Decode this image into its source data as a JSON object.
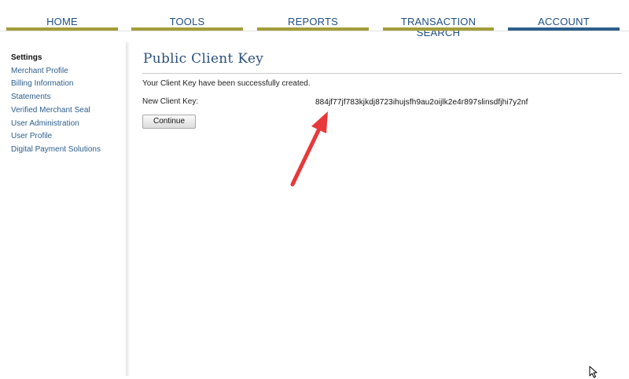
{
  "nav": {
    "tabs": [
      {
        "label": "HOME",
        "bar_color": "#a39d3a",
        "active": false
      },
      {
        "label": "TOOLS",
        "bar_color": "#a39d3a",
        "active": false
      },
      {
        "label": "REPORTS",
        "bar_color": "#a39d3a",
        "active": false
      },
      {
        "label": "TRANSACTION SEARCH",
        "bar_color": "#a39d3a",
        "active": false
      },
      {
        "label": "ACCOUNT",
        "bar_color": "#2d5f8b",
        "active": true
      }
    ]
  },
  "sidebar": {
    "heading": "Settings",
    "items": [
      {
        "label": "Merchant Profile"
      },
      {
        "label": "Billing Information"
      },
      {
        "label": "Statements"
      },
      {
        "label": "Verified Merchant Seal"
      },
      {
        "label": "User Administration"
      },
      {
        "label": "User Profile"
      },
      {
        "label": "Digital Payment Solutions"
      }
    ]
  },
  "main": {
    "title": "Public Client Key",
    "success_message": "Your Client Key have been successfully created.",
    "key_label": "New Client Key:",
    "key_value": "884jf77jf783kjkdj8723ihujsfh9au2oijlk2e4r897slinsdfjhi7y2nf",
    "continue_label": "Continue"
  },
  "colors": {
    "link": "#2d5e8e",
    "title": "#2b4f7a",
    "annotation_arrow": "#e8383a"
  },
  "icons": {
    "annotation": "red-arrow-icon",
    "pointer": "mouse-cursor-icon"
  }
}
